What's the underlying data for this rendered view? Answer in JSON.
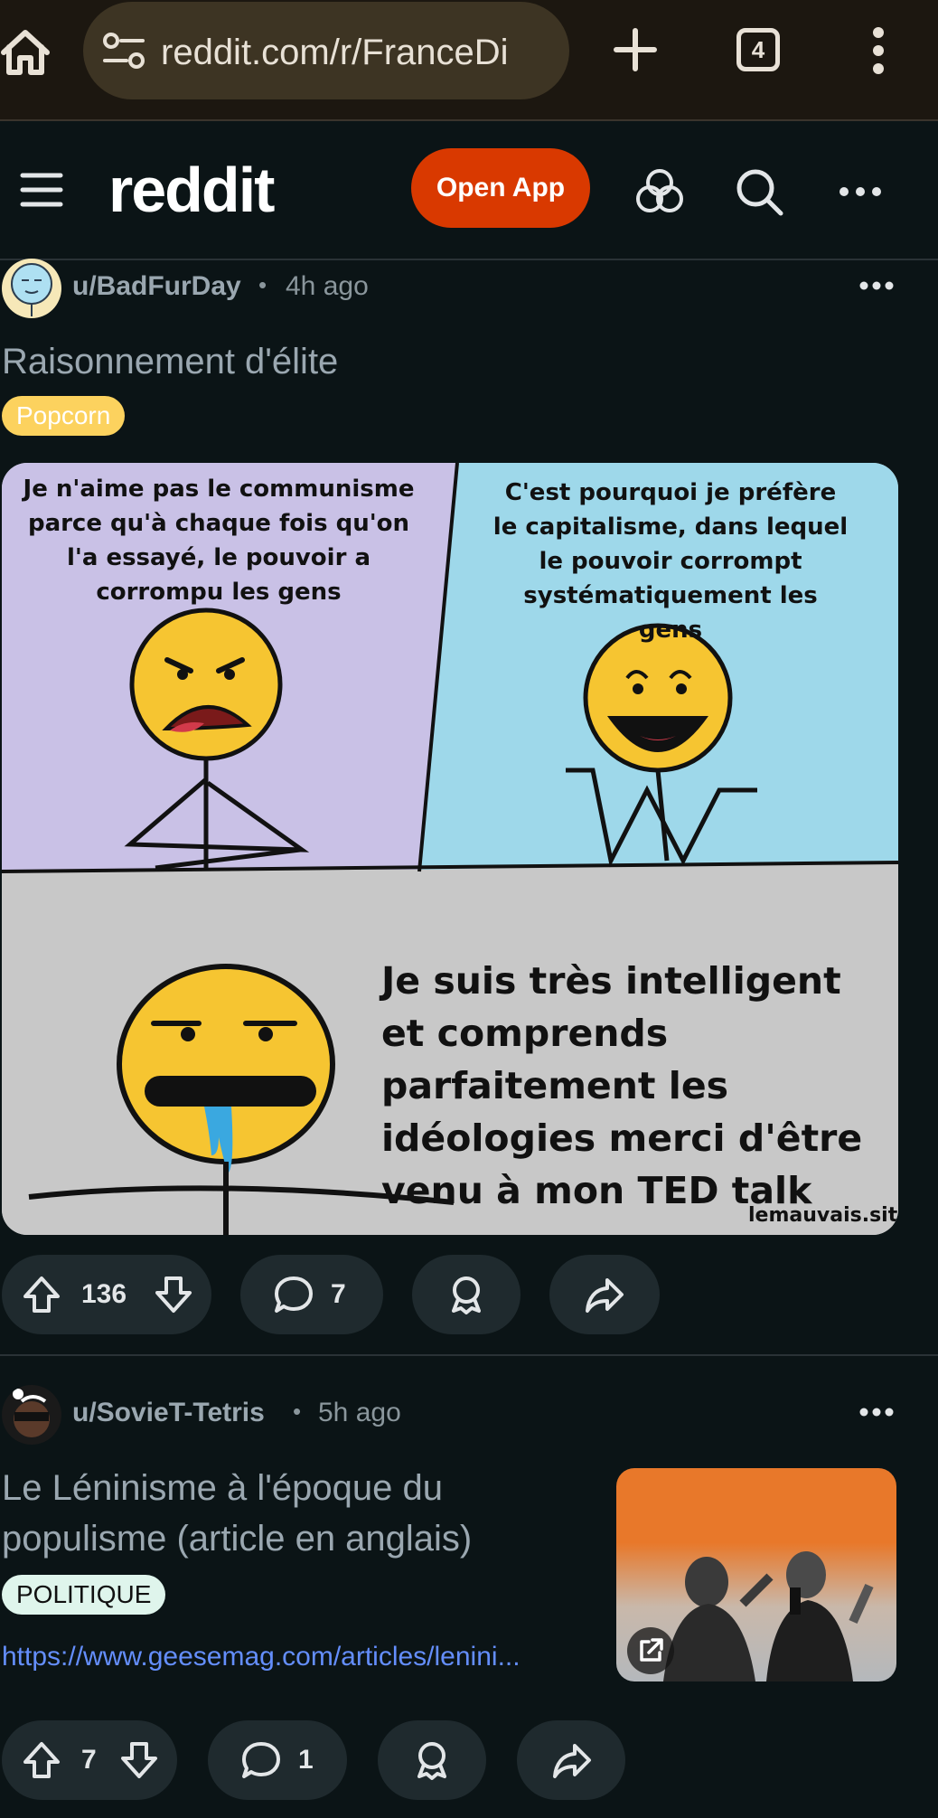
{
  "browser": {
    "url": "reddit.com/r/FranceDi",
    "tab_count": "4"
  },
  "header": {
    "logo": "reddit",
    "open_app_label": "Open App"
  },
  "posts": [
    {
      "username": "u/BadFurDay",
      "separator": "•",
      "time": "4h ago",
      "title": "Raisonnement d'élite",
      "flair": "Popcorn",
      "flair_bg": "#fcd25e",
      "image": {
        "panel1_text": "Je n'aime pas le communisme parce qu'à chaque fois qu'on l'a essayé, le pouvoir a corrompu les gens",
        "panel2_text": "C'est pourquoi je préfère le capitalisme, dans lequel le pouvoir corrompt systématiquement les gens",
        "panel3_text": "Je suis très intelligent et comprends parfaitement les idéologies merci d'être venu à mon TED talk",
        "watermark": "lemauvais.site",
        "colors": {
          "panel1": "#c9c1e6",
          "panel2": "#9ed8ea",
          "panel3": "#c8c8c8",
          "face": "#f6c531"
        }
      },
      "votes": "136",
      "comments": "7"
    },
    {
      "username": "u/SovieT-Tetris",
      "separator": "•",
      "time": "5h ago",
      "title": "Le Léninisme à l'époque du populisme (article en anglais)",
      "flair": "POLITIQUE",
      "flair_bg": "#dff5ec",
      "link": "https://www.geesemag.com/articles/lenini...",
      "votes": "7",
      "comments": "1"
    }
  ],
  "icons": {
    "home": "home-icon",
    "tune": "site-settings-icon",
    "new_tab": "plus-icon",
    "menu": "kebab-menu-icon",
    "hamburger": "hamburger-icon",
    "chat": "chat-bubbles-icon",
    "search": "search-icon",
    "overflow": "more-horizontal-icon",
    "upvote": "upvote-arrow-icon",
    "downvote": "downvote-arrow-icon",
    "comment": "comment-bubble-icon",
    "award": "award-icon",
    "share": "share-arrow-icon",
    "external": "external-link-icon"
  }
}
